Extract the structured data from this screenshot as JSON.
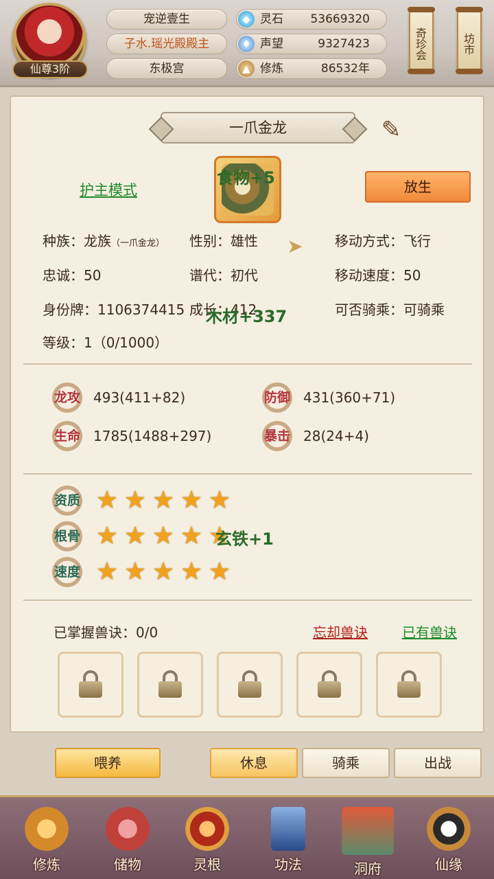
{
  "header": {
    "rank": "仙尊3阶",
    "player_name": "宠逆壹生",
    "title": "子水.瑶光殿殿主",
    "palace": "东极宫",
    "resources": [
      {
        "label": "灵石",
        "value": "53669320",
        "icon": "gem-icon"
      },
      {
        "label": "声望",
        "value": "9327423",
        "icon": "flame-icon"
      },
      {
        "label": "修炼",
        "value": "86532年",
        "icon": "meditation-icon"
      }
    ],
    "side_buttons": [
      "奇珍会",
      "坊市"
    ]
  },
  "pet": {
    "name": "一爪金龙",
    "guard_mode": "护主模式",
    "release": "放生",
    "float_food": "食物+5",
    "float_wood": "木材+337",
    "float_iron": "玄铁+1",
    "info": {
      "race_label": "种族：",
      "race": "龙族",
      "race_sub": "（一爪金龙）",
      "gender": "性别：雄性",
      "move_type": "移动方式：飞行",
      "loyalty": "忠诚：50",
      "generation": "谱代：初代",
      "move_speed": "移动速度：50",
      "id_tag": "身份牌：1106374415",
      "growth": "成长：412",
      "rideable": "可否骑乘：可骑乘",
      "level": "等级：1（0/1000）"
    },
    "stats": [
      {
        "label": "龙攻",
        "value": "493(411+82)"
      },
      {
        "label": "防御",
        "value": "431(360+71)"
      },
      {
        "label": "生命",
        "value": "1785(1488+297)"
      },
      {
        "label": "暴击",
        "value": "28(24+4)"
      }
    ],
    "aptitudes": [
      {
        "label": "资质",
        "stars": 5
      },
      {
        "label": "根骨",
        "stars": 5
      },
      {
        "label": "速度",
        "stars": 5
      }
    ],
    "skills": {
      "mastered": "已掌握兽诀：0/0",
      "forget": "忘却兽诀",
      "owned": "已有兽诀"
    },
    "actions": {
      "feed": "喂养",
      "rest": "休息",
      "ride": "骑乘",
      "battle": "出战"
    }
  },
  "nav": [
    "修炼",
    "储物",
    "灵根",
    "功法",
    "洞府",
    "仙缘"
  ],
  "colors": {
    "accent_orange": "#f08a3a",
    "link_green": "#1e8b2a",
    "link_red": "#b2221a",
    "star": "#f0a21e"
  }
}
